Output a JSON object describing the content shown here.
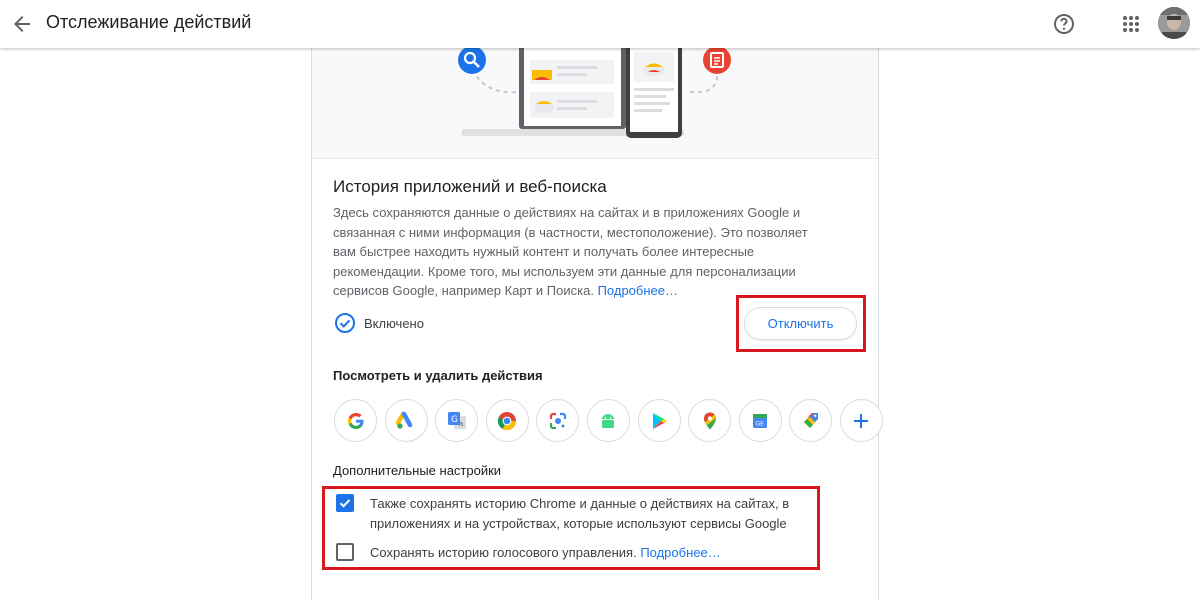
{
  "header": {
    "title": "Отслеживание действий",
    "back_icon": "arrow-back-icon",
    "help_icon": "help-icon",
    "apps_icon": "apps-grid-icon"
  },
  "activity": {
    "title": "История приложений и веб-поиска",
    "description": "Здесь сохраняются данные о действиях на сайтах и в приложениях Google и связанная с ними информация (в частности, местоположение). Это позволяет вам быстрее находить нужный контент и получать более интересные рекомендации. Кроме того, мы используем эти данные для персонализации сервисов Google, например Карт и Поиска.",
    "learn_more": "Подробнее…",
    "status": "Включено",
    "turn_off_button": "Отключить"
  },
  "review": {
    "title": "Посмотреть и удалить действия",
    "apps": [
      "google-icon",
      "google-ads-icon",
      "google-translate-icon",
      "chrome-icon",
      "google-lens-icon",
      "android-icon",
      "google-play-icon",
      "google-maps-icon",
      "google-news-icon",
      "google-shopping-icon",
      "add-icon"
    ]
  },
  "settings": {
    "title": "Дополнительные настройки",
    "chrome_history": "Также сохранять историю Chrome и данные о действиях на сайтах, в приложениях и на устройствах, которые используют сервисы Google",
    "chrome_history_checked": true,
    "voice_history": "Сохранять историю голосового управления.",
    "voice_history_checked": false,
    "voice_learn_more": "Подробнее…"
  },
  "colors": {
    "accent": "#1a73e8",
    "highlight": "#d7191f"
  }
}
